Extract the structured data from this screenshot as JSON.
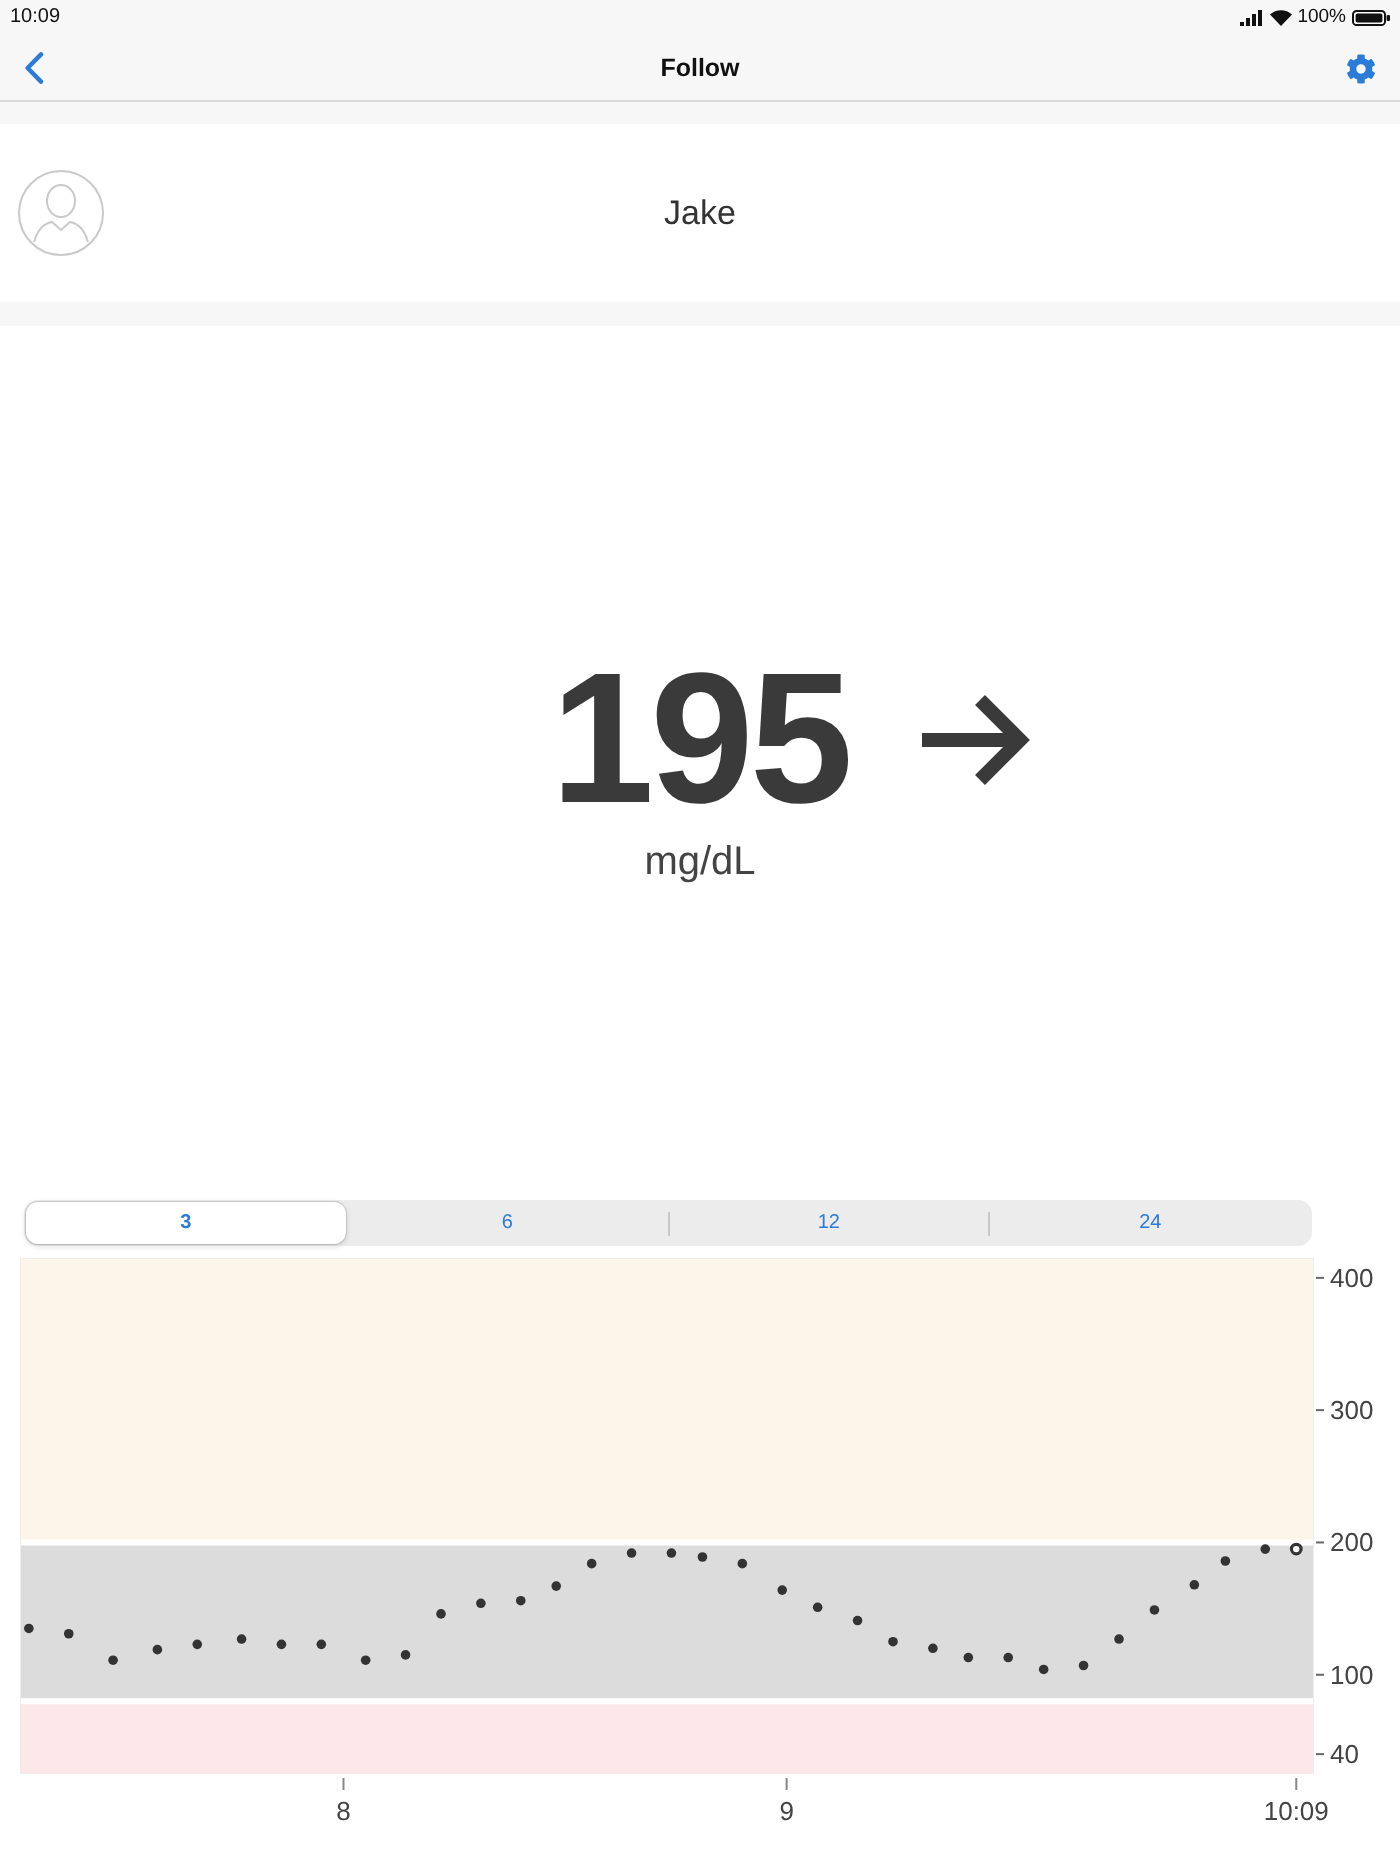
{
  "status_bar": {
    "time": "10:09",
    "battery": "100%"
  },
  "nav_bar": {
    "title": "Follow"
  },
  "profile": {
    "name": "Jake"
  },
  "reading": {
    "value": "195",
    "unit": "mg/dL"
  },
  "range_tabs": [
    {
      "label": "3",
      "selected": true
    },
    {
      "label": "6",
      "selected": false
    },
    {
      "label": "12",
      "selected": false
    },
    {
      "label": "24",
      "selected": false
    }
  ],
  "chart": {
    "chart_data": {
      "type": "scatter",
      "x": [
        7.29,
        7.38,
        7.48,
        7.58,
        7.67,
        7.77,
        7.86,
        7.95,
        8.05,
        8.14,
        8.22,
        8.31,
        8.4,
        8.48,
        8.56,
        8.65,
        8.74,
        8.81,
        8.9,
        8.99,
        9.07,
        9.16,
        9.24,
        9.33,
        9.41,
        9.5,
        9.58,
        9.67,
        9.75,
        9.83,
        9.92,
        9.99,
        10.08,
        10.15
      ],
      "series": [
        {
          "color": "#333333",
          "values": [
            135,
            131,
            111,
            119,
            123,
            127,
            123,
            123,
            111,
            115,
            146,
            154,
            156,
            167,
            184,
            192,
            192,
            189,
            184,
            164,
            151,
            141,
            125,
            120,
            113,
            113,
            104,
            107,
            127,
            149,
            168,
            186,
            195,
            195
          ]
        }
      ],
      "xlim": [
        7.27,
        10.19
      ],
      "ylim": [
        25,
        415
      ],
      "xticks": [
        {
          "value": 8,
          "label": "8"
        },
        {
          "value": 9,
          "label": "9"
        },
        {
          "value": 10.15,
          "label": "10:09"
        }
      ],
      "yticks": [
        40,
        100,
        200,
        300,
        400
      ],
      "bands": [
        {
          "axis": "y",
          "from": 200,
          "to": 415,
          "color": "#fdf5e9"
        },
        {
          "axis": "y",
          "from": 80,
          "to": 200,
          "color": "#dcdcdc"
        },
        {
          "axis": "y",
          "from": 25,
          "to": 80,
          "color": "#fde7e9"
        }
      ]
    }
  }
}
